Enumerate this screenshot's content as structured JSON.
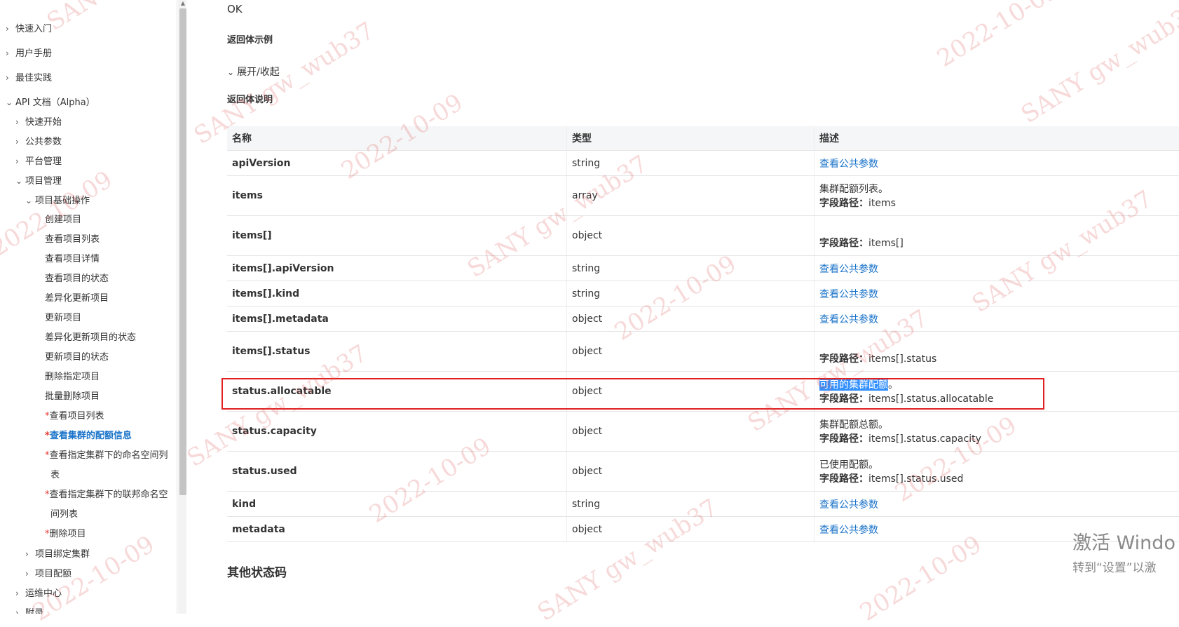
{
  "sidebar": {
    "items": [
      {
        "label": "快速入门",
        "chevron": "›"
      },
      {
        "label": "用户手册",
        "chevron": "›"
      },
      {
        "label": "最佳实践",
        "chevron": "›"
      },
      {
        "label": "API 文档（Alpha）",
        "chevron": "⌄"
      },
      {
        "label": "快速开始",
        "chevron": "›"
      },
      {
        "label": "公共参数",
        "chevron": "›"
      },
      {
        "label": "平台管理",
        "chevron": "›"
      },
      {
        "label": "项目管理",
        "chevron": "⌄"
      },
      {
        "label": "项目基础操作",
        "chevron": "⌄"
      },
      {
        "label": "创建项目"
      },
      {
        "label": "查看项目列表"
      },
      {
        "label": "查看项目详情"
      },
      {
        "label": "查看项目的状态"
      },
      {
        "label": "差异化更新项目"
      },
      {
        "label": "更新项目"
      },
      {
        "label": "差异化更新项目的状态"
      },
      {
        "label": "更新项目的状态"
      },
      {
        "label": "删除指定项目"
      },
      {
        "label": "批量删除项目"
      },
      {
        "label": "查看项目列表",
        "star": "*"
      },
      {
        "label": "查看集群的配额信息",
        "star": "*"
      },
      {
        "label": "查看指定集群下的命名空间列",
        "star": "*"
      },
      {
        "label": "表"
      },
      {
        "label": "查看指定集群下的联邦命名空",
        "star": "*"
      },
      {
        "label": "间列表"
      },
      {
        "label": "删除项目",
        "star": "*"
      },
      {
        "label": "项目绑定集群",
        "chevron": "›"
      },
      {
        "label": "项目配额",
        "chevron": "›"
      },
      {
        "label": "运维中心",
        "chevron": "›"
      },
      {
        "label": "附录",
        "chevron": "›"
      }
    ]
  },
  "main": {
    "status_text": "OK",
    "example_label": "返回体示例",
    "toggle_label": "展开/收起",
    "desc_label": "返回体说明",
    "table": {
      "headers": [
        "名称",
        "类型",
        "描述"
      ],
      "rows": [
        {
          "name": "apiVersion",
          "type": "string",
          "desc_link": "查看公共参数"
        },
        {
          "name": "items",
          "type": "array",
          "desc_text": "集群配额列表。",
          "path_label": "字段路径：",
          "path": "items"
        },
        {
          "name": "items[]",
          "type": "object",
          "path_label": "字段路径：",
          "path": "items[]"
        },
        {
          "name": "items[].apiVersion",
          "type": "string",
          "desc_link": "查看公共参数"
        },
        {
          "name": "items[].kind",
          "type": "string",
          "desc_link": "查看公共参数"
        },
        {
          "name": "items[].metadata",
          "type": "object",
          "desc_link": "查看公共参数"
        },
        {
          "name": "items[].status",
          "type": "object",
          "path_label": "字段路径：",
          "path": "items[].status"
        },
        {
          "name": "status.allocatable",
          "type": "object",
          "desc_highlight": "可用的集群配额",
          "desc_suffix": "。",
          "path_label": "字段路径：",
          "path": "items[].status.allocatable"
        },
        {
          "name": "status.capacity",
          "type": "object",
          "desc_text": "集群配额总额。",
          "path_label": "字段路径：",
          "path": "items[].status.capacity"
        },
        {
          "name": "status.used",
          "type": "object",
          "desc_text": "已使用配额。",
          "path_label": "字段路径：",
          "path": "items[].status.used"
        },
        {
          "name": "kind",
          "type": "string",
          "desc_link": "查看公共参数"
        },
        {
          "name": "metadata",
          "type": "object",
          "desc_link": "查看公共参数"
        }
      ]
    },
    "other_status_title": "其他状态码"
  },
  "activation": {
    "line1": "激活 Windo",
    "line2": "转到“设置”以激"
  },
  "watermark": {
    "user": "SANY gw_wub37",
    "date": "2022-10-09"
  },
  "colors": {
    "link": "#1a73c9",
    "highlight_bg": "#3390ff",
    "red_box": "#e02020",
    "required_star": "#e53935"
  }
}
